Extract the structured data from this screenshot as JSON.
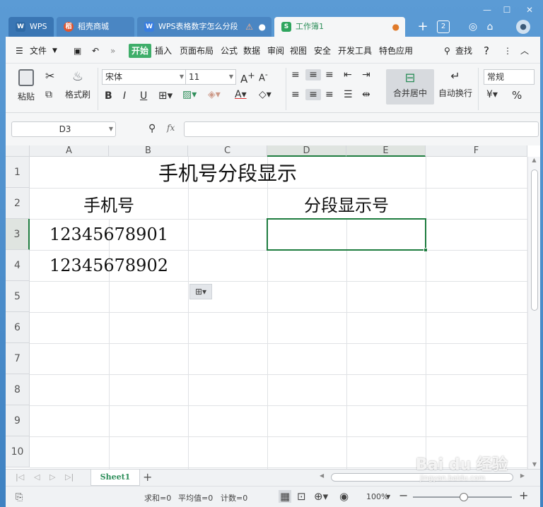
{
  "tabs": [
    {
      "label": "WPS",
      "icon": "wps-logo-icon"
    },
    {
      "label": "稻壳商城",
      "icon": "daoke-icon"
    },
    {
      "label": "WPS表格数字怎么分段",
      "icon": "wps-doc-icon"
    },
    {
      "label": "工作簿1",
      "icon": "spreadsheet-icon"
    }
  ],
  "tabbar": {
    "count_badge": "2",
    "warning_glyph": "⚠"
  },
  "menu": {
    "file": "文件",
    "items": [
      "开始",
      "插入",
      "页面布局",
      "公式",
      "数据",
      "审阅",
      "视图",
      "安全",
      "开发工具",
      "特色应用"
    ],
    "search": "查找"
  },
  "ribbon": {
    "paste": "粘贴",
    "format_painter": "格式刷",
    "font_name": "宋体",
    "font_size": "11",
    "merge_center": "合并居中",
    "auto_wrap": "自动换行",
    "number_format": "常规"
  },
  "formula_bar": {
    "name_box": "D3",
    "fx": "fx",
    "content": ""
  },
  "columns": [
    "A",
    "B",
    "C",
    "D",
    "E",
    "F"
  ],
  "rows": [
    "1",
    "2",
    "3",
    "4",
    "5",
    "6",
    "7",
    "8",
    "9",
    "10"
  ],
  "cells": {
    "title": "手机号分段显示",
    "header_phone": "手机号",
    "header_segmented": "分段显示号",
    "phone1": "12345678901",
    "phone2": "12345678902"
  },
  "sheets": [
    "Sheet1"
  ],
  "status": {
    "sum": "求和=0",
    "average": "平均值=0",
    "count": "计数=0",
    "zoom": "100%"
  },
  "watermark": {
    "brand": "Bai du 经验",
    "url": "jingyan.baidu.com"
  },
  "colors": {
    "accent": "#3fae6a",
    "selection": "#1e7c3f",
    "tabbar": "#4a86c3"
  }
}
